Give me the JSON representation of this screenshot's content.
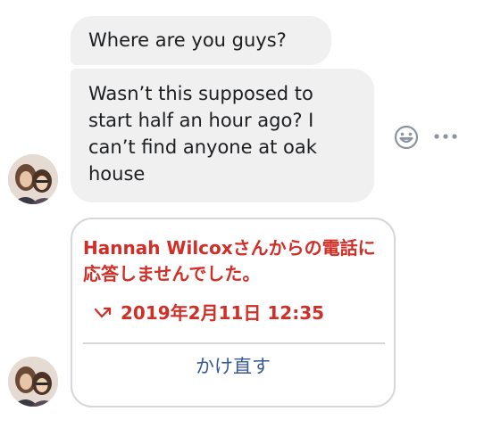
{
  "conversation": {
    "messages": [
      {
        "text": "Where are you guys?"
      },
      {
        "text": "Wasn’t this supposed to start half an hour ago? I can’t find anyone at oak house"
      }
    ],
    "actions": {
      "react_icon": "smiley-face-icon",
      "more_icon": "more-options-icon"
    },
    "missed_call": {
      "message": "Hannah Wilcoxさんからの電話に応答しませんでした。",
      "arrow_icon": "missed-call-arrow-icon",
      "datetime": "2019年2月11日 12:35",
      "callback_label": "かけ直す"
    }
  },
  "colors": {
    "bubble_bg": "#f0f0f0",
    "missed_red": "#d02e26",
    "link_blue": "#385898",
    "card_border": "#d5d7da"
  }
}
